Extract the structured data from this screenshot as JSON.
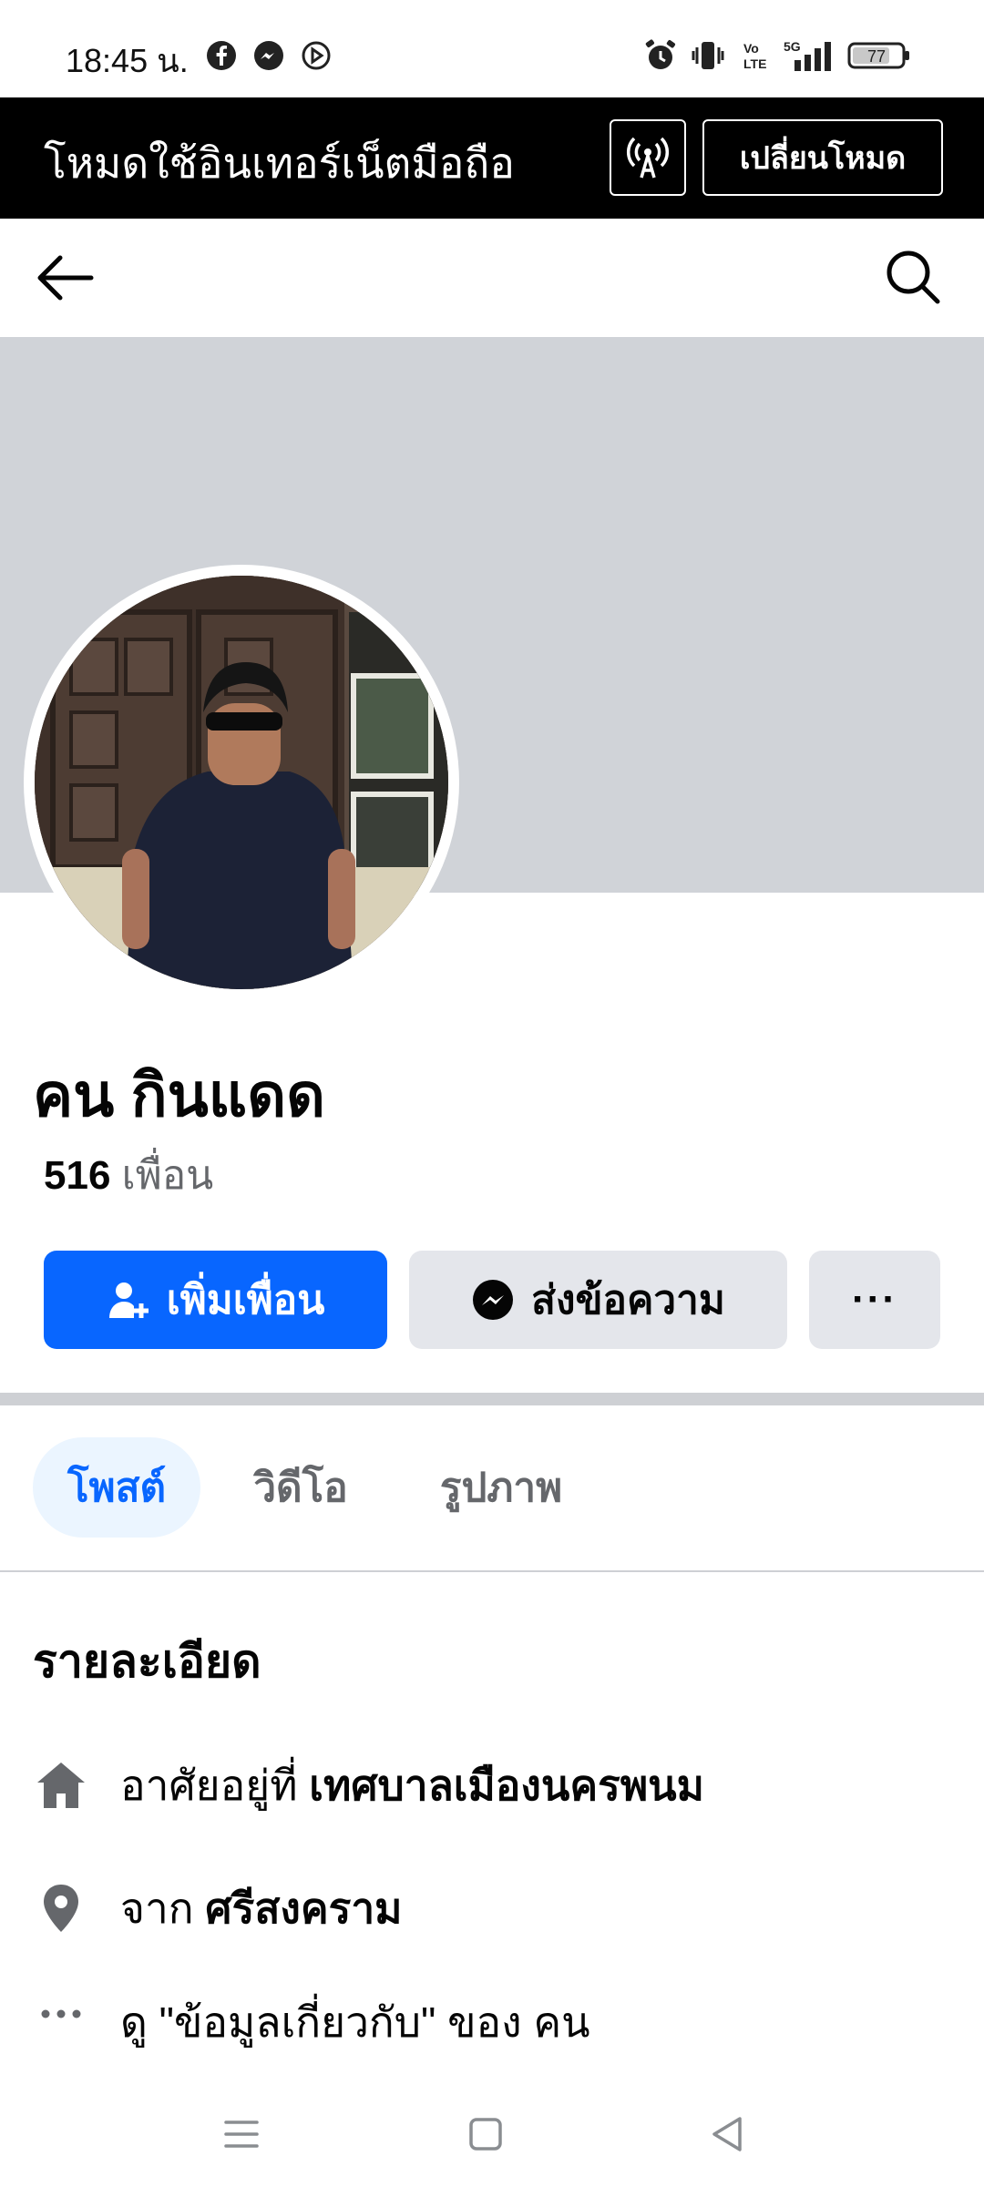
{
  "status_bar": {
    "time": "18:45 น.",
    "battery": "77",
    "left_icons": [
      "facebook-icon",
      "messenger-icon",
      "media-icon"
    ],
    "right_icons": [
      "alarm-icon",
      "vibrate-icon",
      "volte-icon",
      "signal-5g-icon",
      "battery-icon"
    ]
  },
  "banner": {
    "text": "โหมดใช้อินเทอร์เน็ตมือถือ",
    "switch_label": "เปลี่ยนโหมด"
  },
  "profile": {
    "name": "คน กินแดด",
    "friends_count": "516",
    "friends_label": "เพื่อน"
  },
  "actions": {
    "add_friend": "เพิ่มเพื่อน",
    "message": "ส่งข้อความ",
    "more": "···"
  },
  "tabs": [
    {
      "label": "โพสต์",
      "active": true
    },
    {
      "label": "วิดีโอ",
      "active": false
    },
    {
      "label": "รูปภาพ",
      "active": false
    }
  ],
  "details": {
    "title": "รายละเอียด",
    "lives_prefix": "อาศัยอยู่ที่",
    "lives_value": "เทศบาลเมืองนครพนม",
    "from_prefix": "จาก",
    "from_value": "ศรีสงคราม",
    "about_link": "ดู \"ข้อมูลเกี่ยวกับ\" ของ คน"
  },
  "colors": {
    "accent": "#0866ff",
    "cover": "#d0d3d8",
    "button_gray": "#e4e6eb",
    "tab_active_bg": "#ebf5ff"
  }
}
